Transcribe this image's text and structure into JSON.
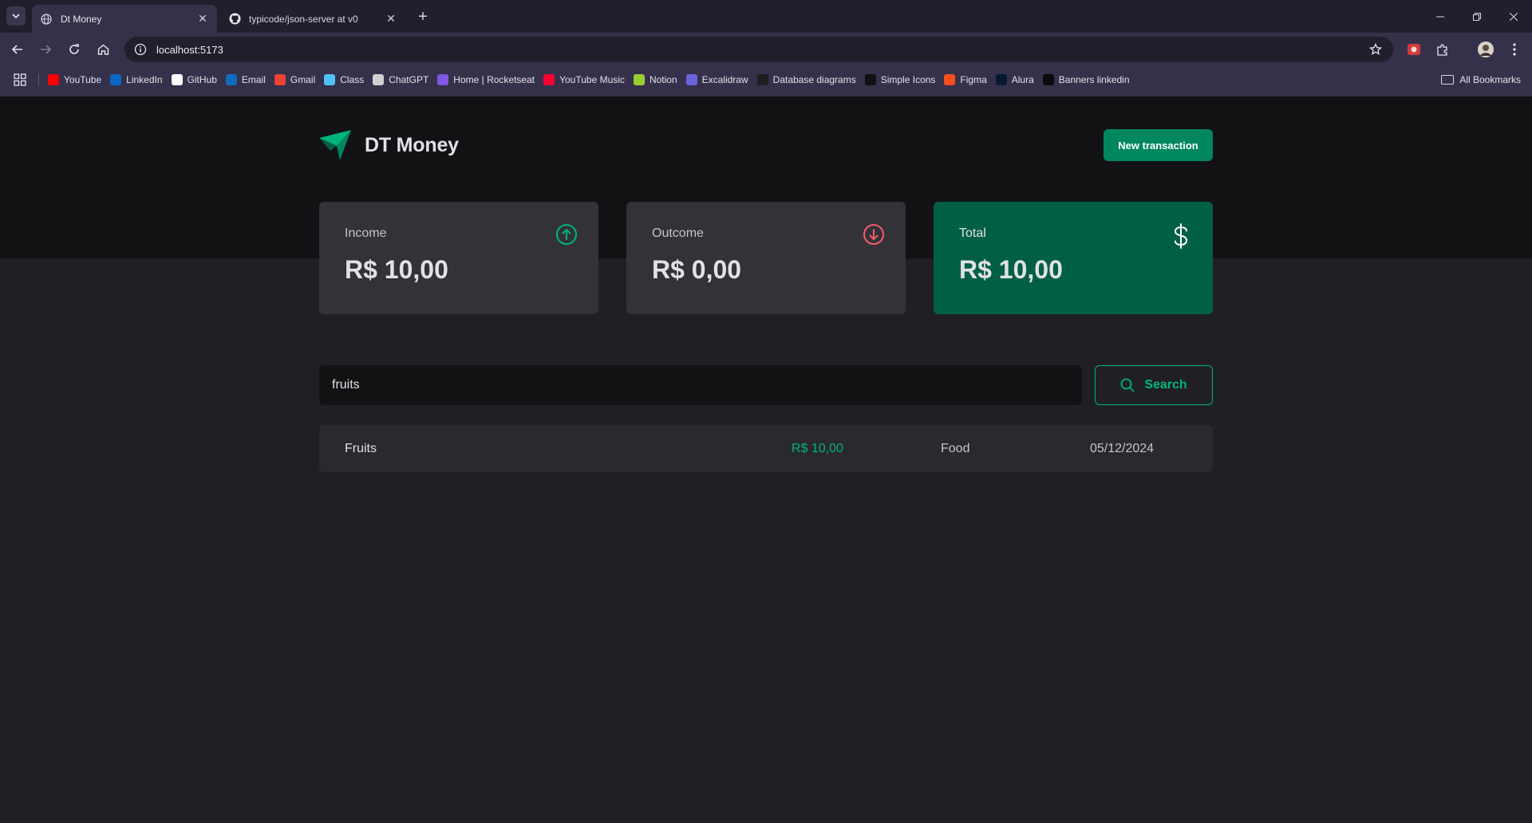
{
  "browser": {
    "tabs": [
      {
        "title": "Dt Money",
        "active": true
      },
      {
        "title": "typicode/json-server at v0",
        "active": false
      }
    ],
    "url": "localhost:5173",
    "bookmarks": [
      {
        "label": "YouTube",
        "icon": "youtube-icon",
        "color": "#ff0000"
      },
      {
        "label": "LinkedIn",
        "icon": "linkedin-icon",
        "color": "#0a66c2"
      },
      {
        "label": "GitHub",
        "icon": "github-icon",
        "color": "#ffffff"
      },
      {
        "label": "Email",
        "icon": "outlook-icon",
        "color": "#0f6cbd"
      },
      {
        "label": "Gmail",
        "icon": "gmail-icon",
        "color": "#ea4335"
      },
      {
        "label": "Class",
        "icon": "class-icon",
        "color": "#4fc3f7"
      },
      {
        "label": "ChatGPT",
        "icon": "chatgpt-icon",
        "color": "#d0d0d0"
      },
      {
        "label": "Home | Rocketseat",
        "icon": "rocketseat-icon",
        "color": "#8257e5"
      },
      {
        "label": "YouTube Music",
        "icon": "youtube-music-icon",
        "color": "#ff0033"
      },
      {
        "label": "Notion",
        "icon": "notion-icon",
        "color": "#9acd32"
      },
      {
        "label": "Excalidraw",
        "icon": "excalidraw-icon",
        "color": "#6965db"
      },
      {
        "label": "Database diagrams",
        "icon": "database-diagrams-icon",
        "color": "#1e1e1e"
      },
      {
        "label": "Simple Icons",
        "icon": "simple-icons-icon",
        "color": "#111111"
      },
      {
        "label": "Figma",
        "icon": "figma-icon",
        "color": "#f24e1e"
      },
      {
        "label": "Alura",
        "icon": "alura-icon",
        "color": "#051933"
      },
      {
        "label": "Banners linkedin",
        "icon": "banners-icon",
        "color": "#0b0b0b"
      }
    ],
    "all_bookmarks": "All Bookmarks"
  },
  "header": {
    "brand": "DT Money",
    "new_transaction": "New transaction"
  },
  "summary": {
    "income": {
      "label": "Income",
      "value": "R$ 10,00"
    },
    "outcome": {
      "label": "Outcome",
      "value": "R$ 0,00"
    },
    "total": {
      "label": "Total",
      "value": "R$ 10,00"
    }
  },
  "search": {
    "value": "fruits",
    "button": "Search"
  },
  "transactions": [
    {
      "description": "Fruits",
      "price": "R$ 10,00",
      "category": "Food",
      "date": "05/12/2024"
    }
  ],
  "colors": {
    "brand_green": "#00875f",
    "income_green": "#00b37e",
    "outcome_red": "#f75a68",
    "total_card": "#015f43"
  }
}
